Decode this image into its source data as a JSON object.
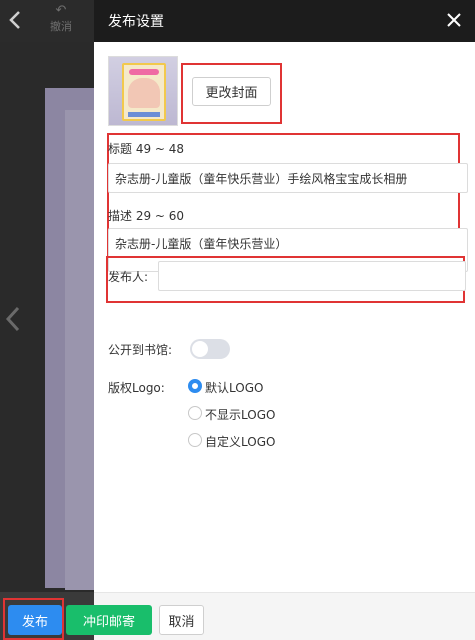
{
  "editor": {
    "undo_label": "撤消",
    "undo_icon": "undo-icon",
    "back_icon": "chevron-left-icon"
  },
  "panel": {
    "title": "发布设置",
    "close_icon": "close-icon",
    "change_cover_label": "更改封面",
    "title_label": "标题 49 ~ 48",
    "title_value": "杂志册-儿童版（童年快乐营业）手绘风格宝宝成长相册",
    "desc_label": "描述 29 ~ 60",
    "desc_value": "杂志册-儿童版（童年快乐营业）",
    "publisher_label": "发布人:",
    "publisher_value": "",
    "public_label": "公开到书馆:",
    "public_on": false,
    "logo_label": "版权Logo:",
    "logo_options": [
      {
        "label": "默认LOGO",
        "checked": true
      },
      {
        "label": "不显示LOGO",
        "checked": false
      },
      {
        "label": "自定义LOGO",
        "checked": false
      }
    ]
  },
  "footer": {
    "publish_label": "发布",
    "print_label": "冲印邮寄",
    "cancel_label": "取消"
  },
  "colors": {
    "primary": "#2d8cf0",
    "success": "#19be6b",
    "highlight": "#e03434",
    "header": "#1c1c1c"
  }
}
